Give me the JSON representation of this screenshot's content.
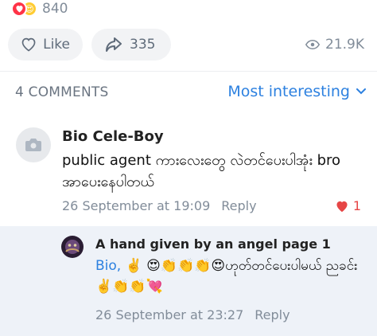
{
  "reactions": {
    "count": "840"
  },
  "actions": {
    "like_label": "Like",
    "share_count": "335",
    "views": "21.9K"
  },
  "comments": {
    "count_label": "4 COMMENTS",
    "sort_label": "Most interesting",
    "items": [
      {
        "author": "Bio Cele-Boy",
        "text": "public agent ကားလေးတွေ လဲတင်ပေးပါအုံး bro အာပေးနေပါတယ်",
        "time": "26 September at 19:09",
        "reply_label": "Reply",
        "likes": "1"
      }
    ],
    "thread": {
      "author": "A hand given by an angel page 1",
      "mention": "Bio,",
      "text": " ✌️ 😍👏👏👏😍ဟုတ်တင်ပေးပါမယ် ညခင်း✌️👏👏💘",
      "time": "26 September at 23:27",
      "reply_label": "Reply"
    }
  },
  "colors": {
    "accent": "#2d81e0",
    "like_red": "#e64646",
    "muted": "#818c99",
    "thread_bg": "#eef2f8"
  }
}
